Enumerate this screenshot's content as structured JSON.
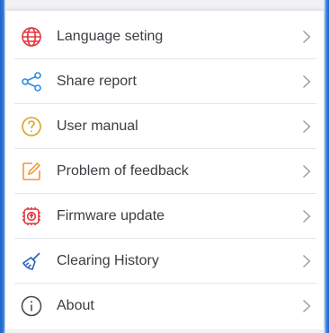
{
  "menu": {
    "items": [
      {
        "label": "Language seting",
        "icon": "globe-icon",
        "color": "#e0353b"
      },
      {
        "label": "Share report",
        "icon": "share-icon",
        "color": "#2e8be6"
      },
      {
        "label": "User manual",
        "icon": "question-icon",
        "color": "#d9a21b"
      },
      {
        "label": "Problem of feedback",
        "icon": "edit-icon",
        "color": "#eb9a3a"
      },
      {
        "label": "Firmware update",
        "icon": "firmware-update-icon",
        "color": "#e0353b"
      },
      {
        "label": "Clearing History",
        "icon": "broom-icon",
        "color": "#2a5fb8"
      },
      {
        "label": "About",
        "icon": "info-icon",
        "color": "#444444"
      }
    ]
  },
  "colors": {
    "text": "#3c3c43",
    "chevron": "#9a9a9e",
    "separator": "#e6e6e8",
    "frame_accent": "#1e63c8"
  }
}
